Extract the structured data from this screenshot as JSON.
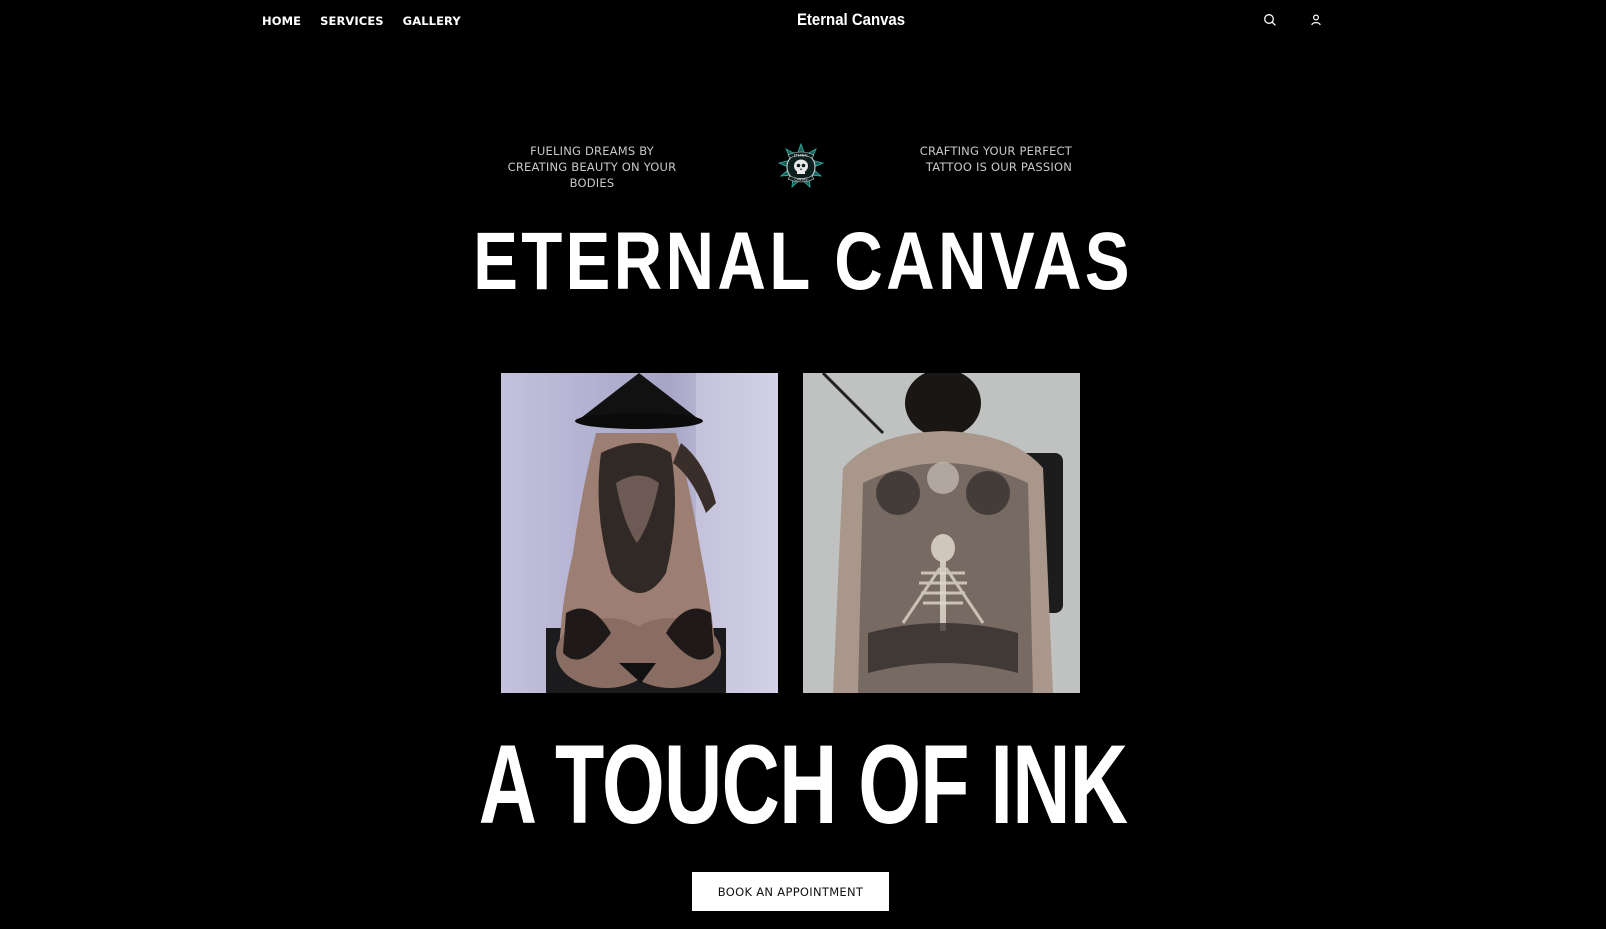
{
  "nav": {
    "items": [
      {
        "label": "HOME"
      },
      {
        "label": "SERVICES"
      },
      {
        "label": "GALLERY"
      }
    ],
    "brand": "Eternal Canvas",
    "icons": [
      "search-icon",
      "user-icon"
    ]
  },
  "hero": {
    "tagline_left": "FUELING DREAMS BY CREATING BEAUTY ON YOUR BODIES",
    "tagline_right": "CRAFTING YOUR PERFECT TATTOO IS OUR PASSION",
    "logo_text_top": "ETERNAL",
    "logo_text_bottom": "CANVAS",
    "title": "ETERNAL CANVAS",
    "subtitle": "A TOUCH OF INK",
    "cta_label": "BOOK AN APPOINTMENT"
  },
  "colors": {
    "background": "#000000",
    "text": "#ffffff",
    "tagline": "#c9c9c9",
    "cta_bg": "#ffffff",
    "cta_text": "#111111",
    "logo_accent": "#2fb7a8"
  }
}
